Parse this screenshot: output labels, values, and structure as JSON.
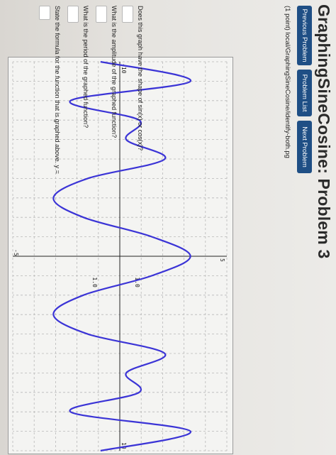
{
  "page": {
    "title": "GraphingSineCosine: Problem 3",
    "problem_header": "(1 point) local/GraphingSineCosine/identify-both.pg"
  },
  "nav": {
    "previous_label": "Previous Problem",
    "list_label": "Problem List",
    "next_label": "Next Problem"
  },
  "questions": [
    {
      "text": "Does this graph have the shape of sin(x) or cos(x)?",
      "value": ""
    },
    {
      "text": "What is the amplitude of the graphed function?",
      "value": ""
    },
    {
      "text": "What is the period of the graphed function?",
      "value": ""
    },
    {
      "text": "State the formula for the function that is graphed above. y =",
      "value": ""
    }
  ],
  "colors": {
    "curve": "#3b34d6",
    "button": "#1f4f85",
    "grid": "#b8b8b8",
    "axis": "#222222"
  },
  "chart_data": {
    "type": "line",
    "x_tick_labels": [
      "-10",
      "10"
    ],
    "y_tick_labels": [
      "5",
      "-5",
      "1.0",
      "1.0"
    ],
    "xlim": [
      -10,
      10
    ],
    "ylim": [
      -5,
      5
    ],
    "grid": true,
    "series": [
      {
        "function": "3.3*cos(1.08*x)",
        "x": [
          -10,
          -9,
          -8,
          -7,
          -6,
          -5,
          -4,
          -3,
          -2,
          -1,
          0,
          1,
          2,
          3,
          4,
          5,
          6,
          7,
          8,
          9,
          10
        ],
        "y": [
          -0.9,
          3.3,
          -2.3,
          0.9,
          0.3,
          2.1,
          -1.5,
          -3.1,
          -1.7,
          1.5,
          3.3,
          1.5,
          -1.7,
          -3.1,
          -1.5,
          2.1,
          0.3,
          0.9,
          -2.3,
          3.3,
          -0.9
        ]
      }
    ]
  }
}
